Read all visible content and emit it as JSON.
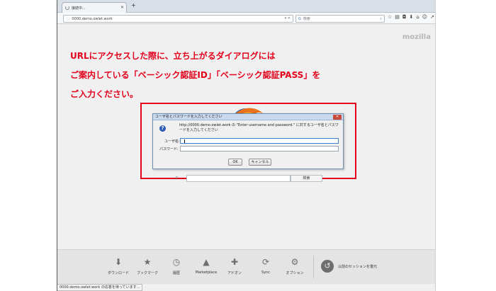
{
  "tab": {
    "title": "接続中..."
  },
  "navbar": {
    "url": "0000.demo.owlet.work",
    "search_placeholder": "検索"
  },
  "brand": "mozilla",
  "notice": {
    "line1": "URLにアクセスした際に、立ち上がるダイアログには",
    "line2": "ご案内している「ベーシック認証ID」「ベーシック認証PASS」を",
    "line3": "ご入力ください。"
  },
  "dialog": {
    "title": "ユーザ名とパスワードを入力してください",
    "message": "http://0000.demo.owlet.work の \"Enter username and password.\" に対するユーザ名とパスワードを入力してください",
    "username_label": "ユーザ名:",
    "password_label": "パスワード:",
    "ok_label": "OK",
    "cancel_label": "キャンセル"
  },
  "homesearch": {
    "button_label": "検索"
  },
  "launcher": {
    "items": [
      {
        "label": "ダウンロード",
        "icon": "download-icon"
      },
      {
        "label": "ブックマーク",
        "icon": "star-icon"
      },
      {
        "label": "履歴",
        "icon": "clock-icon"
      },
      {
        "label": "Marketplace",
        "icon": "rocket-icon"
      },
      {
        "label": "アドオン",
        "icon": "puzzle-icon"
      },
      {
        "label": "Sync",
        "icon": "sync-icon"
      },
      {
        "label": "オプション",
        "icon": "gear-icon"
      }
    ],
    "restore_label": "以前のセッションを復元"
  },
  "status": "0000.demo.owlet.work の応答を待っています..."
}
